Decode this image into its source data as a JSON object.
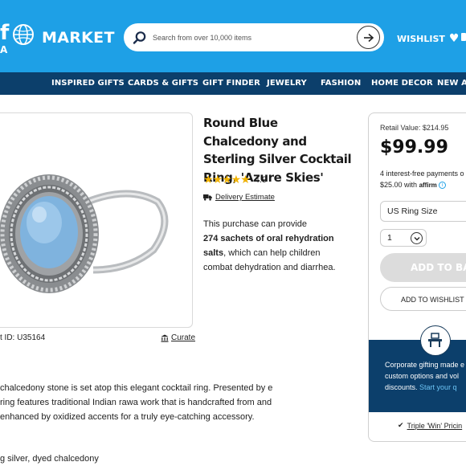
{
  "header": {
    "logo_fragment": "f",
    "logo_fragment_sub": "A",
    "market_label": "MARKET",
    "search_placeholder": "Search from over 10,000 items",
    "wishlist_label": "WISHLIST",
    "colors": {
      "header_bg": "#1ea0e6",
      "nav_bg": "#0c3f6b"
    }
  },
  "nav": {
    "items": [
      "INSPIRED GIFTS",
      "CARDS & GIFTS",
      "GIFT FINDER",
      "JEWELRY",
      "FASHION",
      "HOME DECOR",
      "NEW AR"
    ]
  },
  "product": {
    "title": "Round Blue Chalcedony and Sterling Silver Cocktail Ring, 'Azure Skies'",
    "rating": "4.9",
    "stars": "★★★★★",
    "delivery_label": "Delivery Estimate",
    "impact_prefix": "This purchase can provide",
    "impact_bold": "274 sachets of oral rehydration salts",
    "impact_suffix": ", which can help children combat dehydration and diarrhea.",
    "item_id": "t ID: U35164",
    "curate_label": "Curate",
    "description": "chalcedony stone is set atop this elegant cocktail ring. Presented by e ring features traditional Indian rawa work that is handcrafted from and enhanced by oxidized accents for a truly eye-catching accessory.",
    "materials": "g silver, dyed chalcedony"
  },
  "purchase": {
    "retail_value": "Retail Value: $214.95",
    "price": "$99.99",
    "installments_line1": "4 interest-free payments o",
    "installments_line2": "$25.00 with",
    "affirm": "affirm",
    "size_label": "US Ring Size",
    "quantity": "1",
    "add_to_bag": "ADD TO BAG",
    "add_to_wishlist": "ADD TO WISHLIST",
    "corporate_line1": "Corporate gifting made e",
    "corporate_line2": "custom options and vol",
    "corporate_line3": "discounts.",
    "corporate_link": "Start your q",
    "triple_win": "Triple 'Win' Pricin"
  }
}
